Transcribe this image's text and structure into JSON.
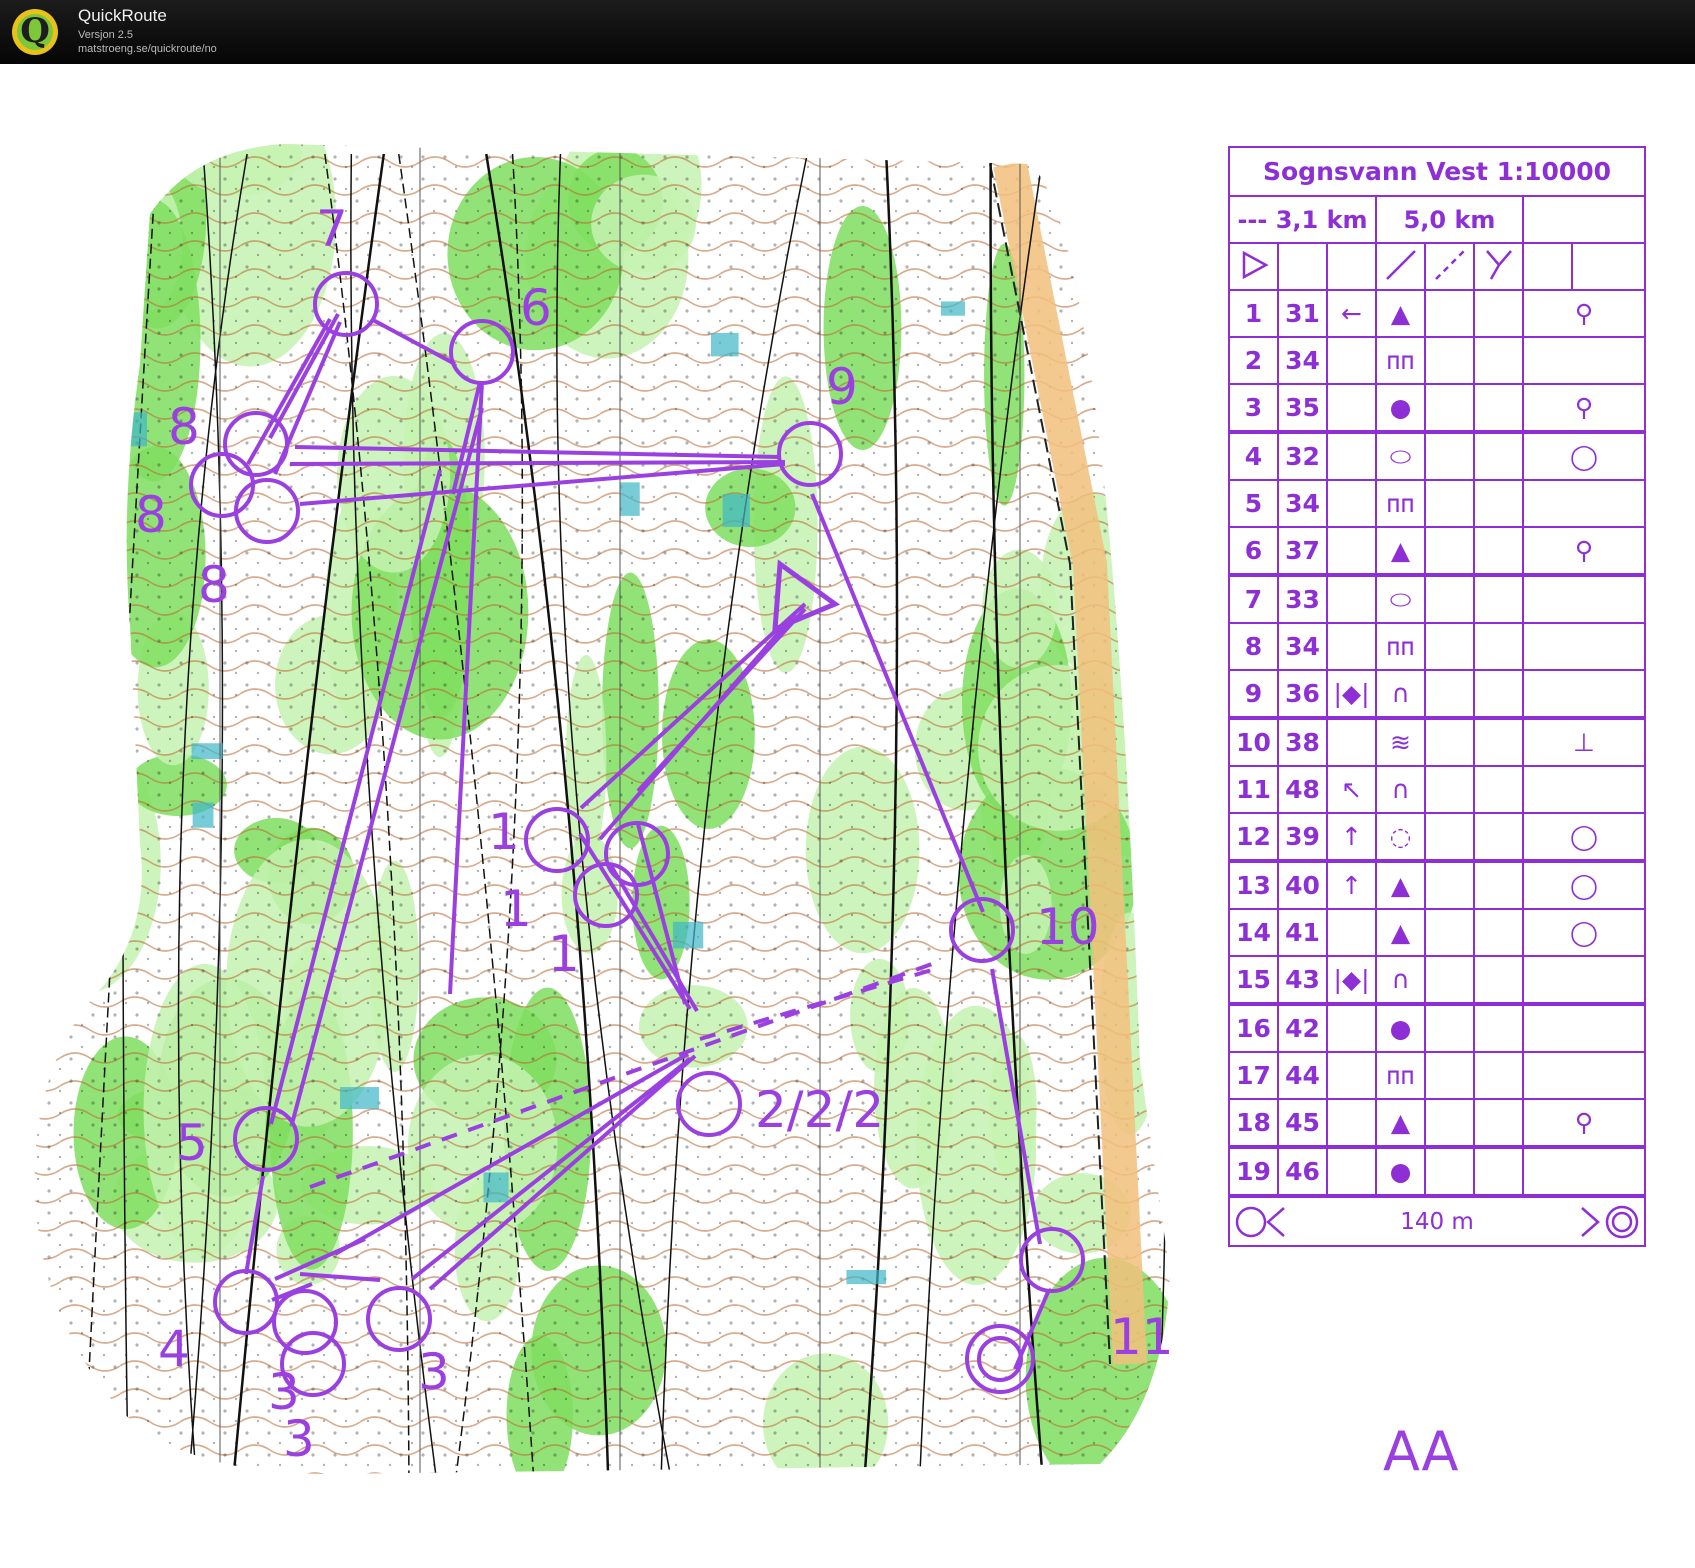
{
  "app": {
    "title": "QuickRoute",
    "version": "Versjon 2.5",
    "url": "matstroeng.se/quickroute/no",
    "logo_letter": "Q"
  },
  "colors": {
    "course": "#9a40e0",
    "forest": "#7fde5f",
    "light_forest": "#c6f2b2",
    "contour": "#b8672e",
    "path": "#111111",
    "marsh": "#3fb6c8",
    "road": "#f2bf7d"
  },
  "map": {
    "control_labels": [
      {
        "id": "label-start-1a",
        "text": "1"
      },
      {
        "id": "label-start-1b",
        "text": "1"
      },
      {
        "id": "label-start-1c",
        "text": "1"
      },
      {
        "id": "label-2",
        "text": "2/2/2"
      },
      {
        "id": "label-3a",
        "text": "3"
      },
      {
        "id": "label-3b",
        "text": "3"
      },
      {
        "id": "label-3c",
        "text": "3"
      },
      {
        "id": "label-4",
        "text": "4"
      },
      {
        "id": "label-5",
        "text": "5"
      },
      {
        "id": "label-6",
        "text": "6"
      },
      {
        "id": "label-7",
        "text": "7"
      },
      {
        "id": "label-8a",
        "text": "8"
      },
      {
        "id": "label-8b",
        "text": "8"
      },
      {
        "id": "label-8c",
        "text": "8"
      },
      {
        "id": "label-9",
        "text": "9"
      },
      {
        "id": "label-10",
        "text": "10"
      },
      {
        "id": "label-11",
        "text": "11"
      }
    ]
  },
  "control_card": {
    "title": "Sognsvann Vest 1:10000",
    "length_marked": "--- 3,1 km",
    "length_total": "5,0 km",
    "rows": [
      {
        "num": "1",
        "code": "31",
        "col_c": "←",
        "col_d": "▲",
        "col_e": "",
        "col_f": "",
        "col_g": "⚲"
      },
      {
        "num": "2",
        "code": "34",
        "col_c": "",
        "col_d": "ᴨᴨ",
        "col_e": "",
        "col_f": "",
        "col_g": ""
      },
      {
        "num": "3",
        "code": "35",
        "col_c": "",
        "col_d": "●",
        "col_e": "",
        "col_f": "",
        "col_g": "⚲"
      },
      {
        "num": "4",
        "code": "32",
        "col_c": "",
        "col_d": "⬭",
        "col_e": "",
        "col_f": "",
        "col_g": "◯"
      },
      {
        "num": "5",
        "code": "34",
        "col_c": "",
        "col_d": "ᴨᴨ",
        "col_e": "",
        "col_f": "",
        "col_g": ""
      },
      {
        "num": "6",
        "code": "37",
        "col_c": "",
        "col_d": "▲",
        "col_e": "",
        "col_f": "",
        "col_g": "⚲"
      },
      {
        "num": "7",
        "code": "33",
        "col_c": "",
        "col_d": "⬭",
        "col_e": "",
        "col_f": "",
        "col_g": ""
      },
      {
        "num": "8",
        "code": "34",
        "col_c": "",
        "col_d": "ᴨᴨ",
        "col_e": "",
        "col_f": "",
        "col_g": ""
      },
      {
        "num": "9",
        "code": "36",
        "col_c": "|◆|",
        "col_d": "∩",
        "col_e": "",
        "col_f": "",
        "col_g": ""
      },
      {
        "num": "10",
        "code": "38",
        "col_c": "",
        "col_d": "≋",
        "col_e": "",
        "col_f": "",
        "col_g": "⊥"
      },
      {
        "num": "11",
        "code": "48",
        "col_c": "↖",
        "col_d": "∩",
        "col_e": "",
        "col_f": "",
        "col_g": ""
      },
      {
        "num": "12",
        "code": "39",
        "col_c": "↑",
        "col_d": "◌",
        "col_e": "",
        "col_f": "",
        "col_g": "◯"
      },
      {
        "num": "13",
        "code": "40",
        "col_c": "↑",
        "col_d": "▲",
        "col_e": "",
        "col_f": "",
        "col_g": "◯"
      },
      {
        "num": "14",
        "code": "41",
        "col_c": "",
        "col_d": "▲",
        "col_e": "",
        "col_f": "",
        "col_g": "◯"
      },
      {
        "num": "15",
        "code": "43",
        "col_c": "|◆|",
        "col_d": "∩",
        "col_e": "",
        "col_f": "",
        "col_g": ""
      },
      {
        "num": "16",
        "code": "42",
        "col_c": "",
        "col_d": "●",
        "col_e": "",
        "col_f": "",
        "col_g": ""
      },
      {
        "num": "17",
        "code": "44",
        "col_c": "",
        "col_d": "ᴨᴨ",
        "col_e": "",
        "col_f": "",
        "col_g": ""
      },
      {
        "num": "18",
        "code": "45",
        "col_c": "",
        "col_d": "▲",
        "col_e": "",
        "col_f": "",
        "col_g": "⚲"
      },
      {
        "num": "19",
        "code": "46",
        "col_c": "",
        "col_d": "●",
        "col_e": "",
        "col_f": "",
        "col_g": ""
      }
    ],
    "finish_distance": "140 m"
  },
  "class_label": "AA"
}
